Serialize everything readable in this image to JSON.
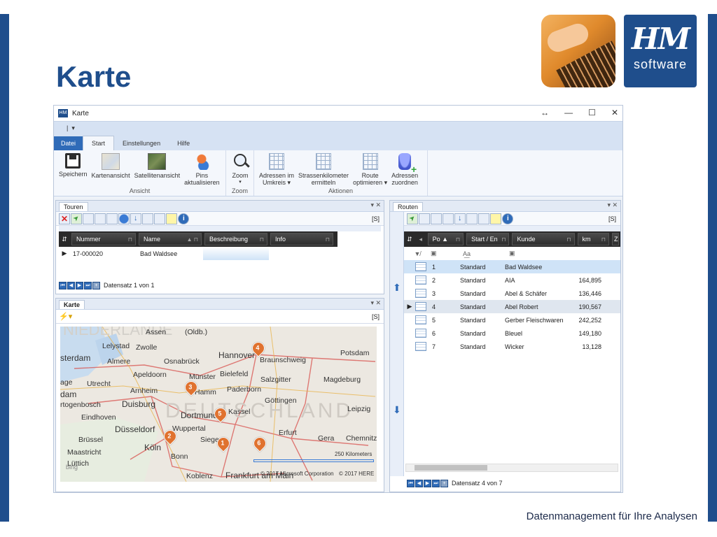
{
  "slide": {
    "title": "Karte",
    "footer": "Datenmanagement für Ihre Analysen",
    "logo_main": "HM",
    "logo_sub": "software"
  },
  "window": {
    "title": "Karte",
    "controls": [
      "↔",
      "—",
      "☐",
      "✕"
    ]
  },
  "ribbon": {
    "tabs": [
      "Datei",
      "Start",
      "Einstellungen",
      "Hilfe"
    ],
    "active_tab": "Start",
    "groups": [
      {
        "label": "Ansicht",
        "buttons": [
          "Speichern",
          "Kartenansicht",
          "Satellitenansicht",
          "Pins\naktualisieren"
        ]
      },
      {
        "label": "Zoom",
        "buttons": [
          "Zoom"
        ]
      },
      {
        "label": "Aktionen",
        "buttons": [
          "Adressen im\nUmkreis ▾",
          "Strassenkilometer\nermitteln",
          "Route\noptimieren ▾",
          "Adressen\nzuordnen"
        ]
      }
    ]
  },
  "touren": {
    "panel_title": "Touren",
    "s_button": "[S]",
    "columns": [
      "Nummer",
      "Name",
      "Beschreibung",
      "Info"
    ],
    "rows": [
      {
        "nummer": "17-000020",
        "name": "Bad Waldsee",
        "beschreibung": "",
        "info": ""
      }
    ],
    "record_status": "Datensatz 1 von 1"
  },
  "karte": {
    "panel_title": "Karte",
    "s_button": "[S]",
    "scale": "250 Kilometers",
    "copyright_ms": "© 2017 Microsoft Corporation",
    "copyright_here": "© 2017 HERE",
    "provider": "bing",
    "cities": [
      "Assen",
      "(Oldb.)",
      "Lelystad",
      "Zwolle",
      "Hannover",
      "Braunschweig",
      "Potsdam",
      "sterdam",
      "Almere",
      "Osnabrück",
      "Apeldoorn",
      "Bielefeld",
      "age",
      "Utrecht",
      "Münster",
      "Paderborn",
      "Salzgitter",
      "Magdeburg",
      "dam",
      "Arnheim",
      "Hamm",
      "rtogenbosch",
      "Duisburg",
      "Göttingen",
      "Leipzig",
      "Eindhoven",
      "Dortmund",
      "Kassel",
      "Düsseldorf",
      "Wuppertal",
      "Erfurt",
      "Brüssel",
      "Siegen",
      "Gera",
      "Chemnitz",
      "Köln",
      "Maastricht",
      "Bonn",
      "Lüttich",
      "Koblenz",
      "Frankfurt am Main",
      "NIEDERLANDE",
      "DEUTSCHLAND"
    ],
    "pins": [
      "1",
      "2",
      "3",
      "4",
      "5",
      "6"
    ]
  },
  "routen": {
    "panel_title": "Routen",
    "s_button": "[S]",
    "columns": [
      "Po ▲",
      "Start / En",
      "Kunde",
      "km",
      "Z"
    ],
    "filter_symbols": [
      "▣",
      "A͟a",
      "▣"
    ],
    "rows": [
      {
        "po": "1",
        "start": "Standard",
        "kunde": "Bad Waldsee",
        "km": ""
      },
      {
        "po": "2",
        "start": "Standard",
        "kunde": "AIA",
        "km": "164,895"
      },
      {
        "po": "3",
        "start": "Standard",
        "kunde": "Abel & Schäfer",
        "km": "136,446"
      },
      {
        "po": "4",
        "start": "Standard",
        "kunde": "Abel Robert",
        "km": "190,567"
      },
      {
        "po": "5",
        "start": "Standard",
        "kunde": "Gerber Fleischwaren",
        "km": "242,252"
      },
      {
        "po": "6",
        "start": "Standard",
        "kunde": "Bleuel",
        "km": "149,180"
      },
      {
        "po": "7",
        "start": "Standard",
        "kunde": "Wicker",
        "km": "13,128"
      }
    ],
    "record_status": "Datensatz 4 von 7"
  },
  "colors": {
    "brand_blue": "#1f4e8c",
    "pin_orange": "#e0722f",
    "selected_row": "#cfe3f7"
  }
}
